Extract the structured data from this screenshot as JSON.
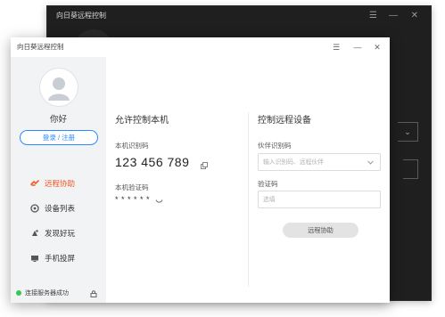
{
  "background_window": {
    "title": "向日葵远程控制",
    "menu_icon": "hamburger-icon",
    "minimize_icon": "minimize-icon",
    "close_icon": "close-icon"
  },
  "window": {
    "title": "向日葵远程控制",
    "menu_icon": "hamburger-icon",
    "minimize_icon": "minimize-icon",
    "close_icon": "close-icon"
  },
  "sidebar": {
    "greeting": "你好",
    "login_label": "登录 / 注册",
    "items": [
      {
        "label": "远程协助",
        "icon": "remote-assist-icon",
        "active": true
      },
      {
        "label": "设备列表",
        "icon": "device-list-icon",
        "active": false
      },
      {
        "label": "发现好玩",
        "icon": "discover-icon",
        "active": false
      },
      {
        "label": "手机投屏",
        "icon": "screen-cast-icon",
        "active": false
      }
    ],
    "status_text": "连接服务器成功"
  },
  "allow_control": {
    "title": "允许控制本机",
    "id_label": "本机识别码",
    "id_value": "123 456 789",
    "code_label": "本机验证码",
    "code_value": "* * * * * *"
  },
  "control_remote": {
    "title": "控制远程设备",
    "partner_label": "伙伴识别码",
    "partner_placeholder": "输入识别码、远程伙伴",
    "verify_label": "验证码",
    "verify_placeholder": "选填",
    "connect_label": "远程协助"
  },
  "colors": {
    "accent": "#2a8bff",
    "active_nav": "#f15a24",
    "status_ok": "#35c759",
    "background_window": "#1f1f1f"
  }
}
